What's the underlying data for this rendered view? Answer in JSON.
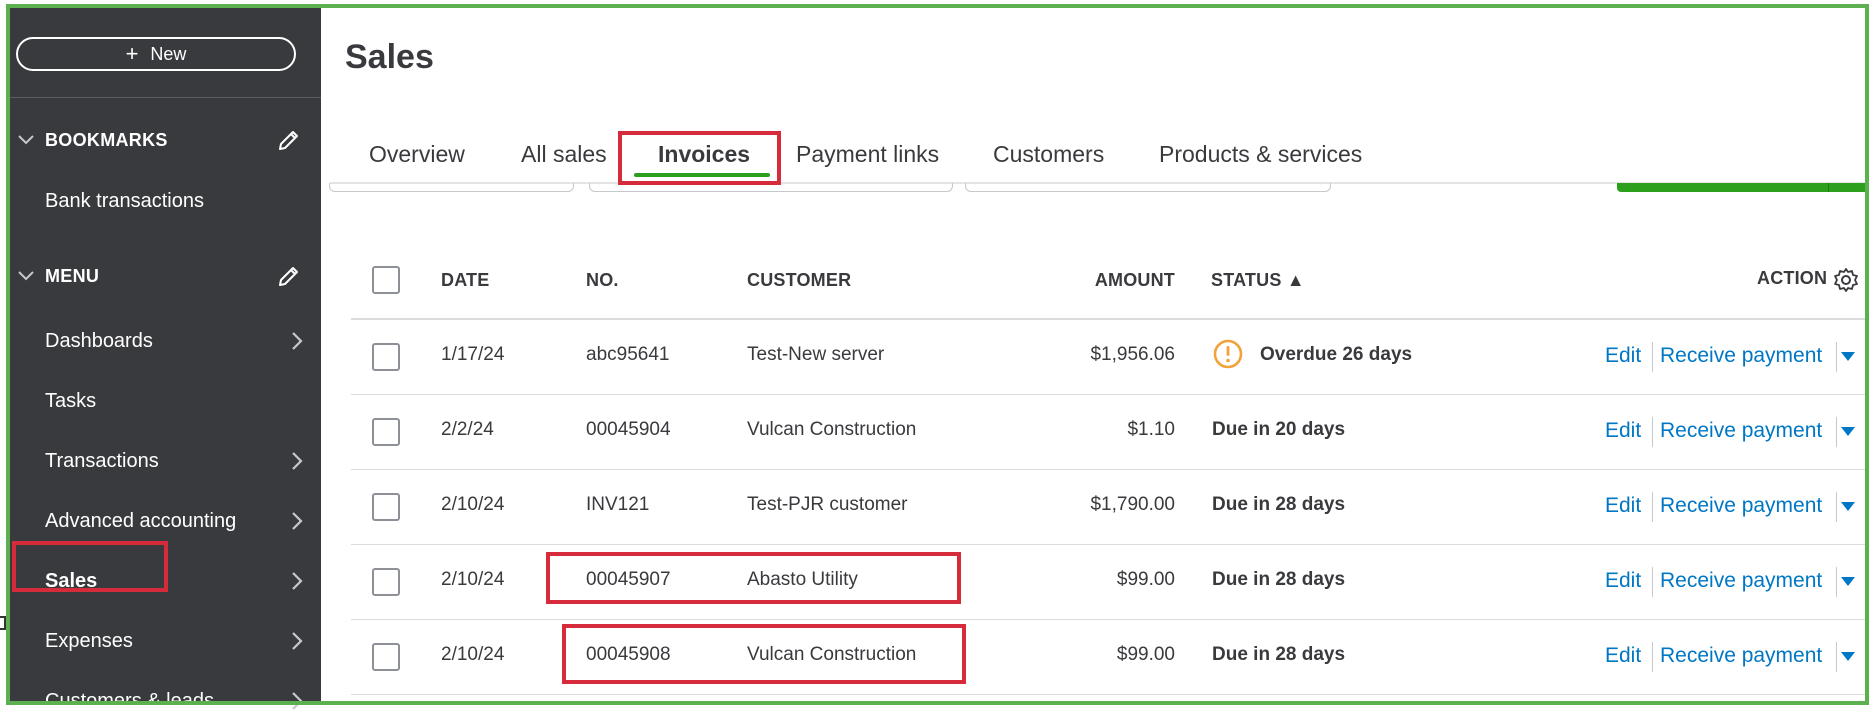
{
  "sidebar": {
    "new_label": "New",
    "bookmarks_header": "BOOKMARKS",
    "bookmarks": [
      {
        "label": "Bank transactions"
      }
    ],
    "menu_header": "MENU",
    "menu": [
      {
        "label": "Dashboards",
        "arrow": true
      },
      {
        "label": "Tasks",
        "arrow": false
      },
      {
        "label": "Transactions",
        "arrow": true
      },
      {
        "label": "Advanced accounting",
        "arrow": true
      },
      {
        "label": "Sales",
        "arrow": true,
        "active": true
      },
      {
        "label": "Expenses",
        "arrow": true
      },
      {
        "label": "Customers & leads",
        "arrow": true
      }
    ]
  },
  "page": {
    "title": "Sales",
    "tabs": [
      "Overview",
      "All sales",
      "Invoices",
      "Payment links",
      "Customers",
      "Products & services"
    ],
    "active_tab": "Invoices"
  },
  "table": {
    "headers": {
      "date": "DATE",
      "no": "NO.",
      "customer": "CUSTOMER",
      "amount": "AMOUNT",
      "status": "STATUS ▲",
      "action": "ACTION"
    },
    "rows": [
      {
        "date": "1/17/24",
        "no": "abc95641",
        "customer": "Test-New server",
        "amount": "$1,956.06",
        "status": "Overdue 26 days",
        "overdue": true,
        "edit": "Edit",
        "action": "Receive payment"
      },
      {
        "date": "2/2/24",
        "no": "00045904",
        "customer": "Vulcan Construction",
        "amount": "$1.10",
        "status": "Due in 20 days",
        "overdue": false,
        "edit": "Edit",
        "action": "Receive payment"
      },
      {
        "date": "2/10/24",
        "no": "INV121",
        "customer": "Test-PJR customer",
        "amount": "$1,790.00",
        "status": "Due in 28 days",
        "overdue": false,
        "edit": "Edit",
        "action": "Receive payment"
      },
      {
        "date": "2/10/24",
        "no": "00045907",
        "customer": "Abasto Utility",
        "amount": "$99.00",
        "status": "Due in 28 days",
        "overdue": false,
        "edit": "Edit",
        "action": "Receive payment"
      },
      {
        "date": "2/10/24",
        "no": "00045908",
        "customer": "Vulcan Construction",
        "amount": "$99.00",
        "status": "Due in 28 days",
        "overdue": false,
        "edit": "Edit",
        "action": "Receive payment"
      }
    ]
  },
  "colors": {
    "sidebar_bg": "#393a3d",
    "accent_green": "#2ca01c",
    "link_blue": "#0077c5",
    "warning_orange": "#f2a23a",
    "highlight_red": "#d52b3a",
    "frame_green": "#5cb04f"
  },
  "icons": {
    "new": "plus-icon",
    "section_toggle": "chevron-down-icon",
    "edit_section": "pencil-icon",
    "menu_arrow": "chevron-right-icon",
    "table_settings": "gear-icon",
    "overdue": "warning-circle-icon",
    "action_more": "caret-down-icon"
  }
}
